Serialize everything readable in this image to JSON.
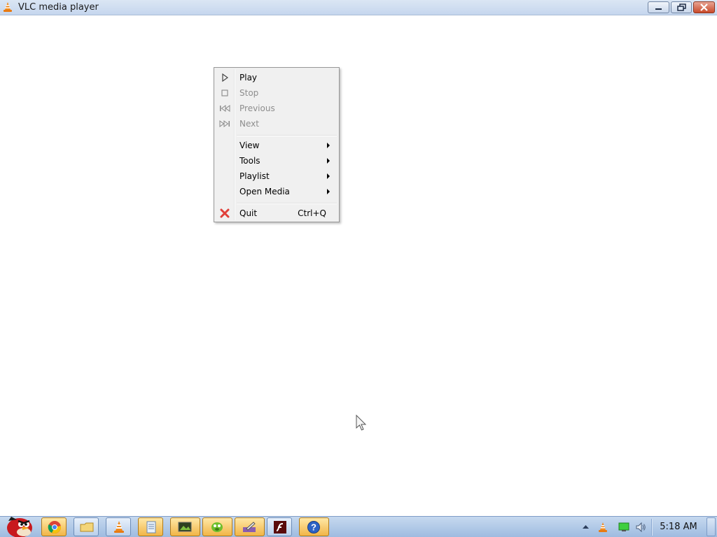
{
  "window": {
    "title": "VLC media player",
    "app_icon": "vlc-cone-icon",
    "controls": [
      "minimize",
      "restore",
      "close"
    ]
  },
  "context_menu": {
    "items": [
      {
        "label": "Play",
        "icon": "play-icon",
        "enabled": true
      },
      {
        "label": "Stop",
        "icon": "stop-icon",
        "enabled": false
      },
      {
        "label": "Previous",
        "icon": "previous-icon",
        "enabled": false
      },
      {
        "label": "Next",
        "icon": "next-icon",
        "enabled": false
      },
      {
        "label": "View",
        "submenu": true,
        "enabled": true
      },
      {
        "label": "Tools",
        "submenu": true,
        "enabled": true
      },
      {
        "label": "Playlist",
        "submenu": true,
        "enabled": true
      },
      {
        "label": "Open Media",
        "submenu": true,
        "enabled": true
      },
      {
        "label": "Quit",
        "icon": "quit-x-icon",
        "shortcut": "Ctrl+Q",
        "enabled": true
      }
    ]
  },
  "taskbar": {
    "start_icon": "angry-bird-start-icon",
    "buttons": [
      {
        "icon": "chrome-icon",
        "active": true
      },
      {
        "icon": "folder-icon",
        "active": false
      },
      {
        "icon": "vlc-cone-icon",
        "active": false
      },
      {
        "icon": "notepad-icon",
        "active": true
      },
      {
        "icon": "image-viewer-icon",
        "active": true
      },
      {
        "icon": "game-icon",
        "active": true
      },
      {
        "icon": "paint-icon",
        "active": true
      },
      {
        "icon": "flash-icon",
        "active": false
      },
      {
        "icon": "help-icon",
        "active": true
      }
    ],
    "tray": {
      "icons": [
        "show-hidden-icons-arrow",
        "vlc-cone-icon",
        "network-icon",
        "volume-icon"
      ],
      "clock": "5:18 AM"
    }
  },
  "colors": {
    "titlebar": "#c5d6ee",
    "menu_bg": "#f0f0f0",
    "disabled_text": "#8d8d8d",
    "quit_icon": "#e0403a",
    "taskbar": "#9fbbe0"
  }
}
